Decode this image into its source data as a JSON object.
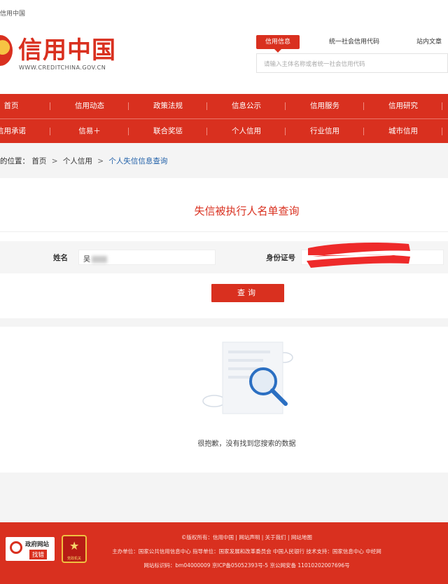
{
  "topbar": {
    "site_link": "信用中国"
  },
  "header": {
    "logo_text": "信用中国",
    "logo_url": "WWW.CREDITCHINA.GOV.CN",
    "search_tabs": [
      "信用信息",
      "统一社会信用代码",
      "站内文章"
    ],
    "search_placeholder": "请输入主体名称或者统一社会信用代码"
  },
  "nav": {
    "row1": [
      "首页",
      "信用动态",
      "政策法规",
      "信息公示",
      "信用服务",
      "信用研究"
    ],
    "row2": [
      "信用承诺",
      "信易＋",
      "联合奖惩",
      "个人信用",
      "行业信用",
      "城市信用"
    ]
  },
  "breadcrumb": {
    "prefix": "的位置：",
    "home": "首页",
    "section": "个人信用",
    "current": "个人失信信息查询",
    "sep": ">"
  },
  "query": {
    "title": "失信被执行人名单查询",
    "name_label": "姓名",
    "name_value": "吴",
    "id_label": "身份证号",
    "submit_label": "查询"
  },
  "result": {
    "empty_message": "很抱歉，没有找到您搜索的数据"
  },
  "footer": {
    "line1": "©版权所有：信用中国 | 网站声明 | 关于我们 | 网站地图",
    "line2": "主办单位：国家公共信用信息中心   指导单位：国家发展和改革委员会 中国人民银行   技术支持：国家信息中心 中经网",
    "line3": "网站标识码：bm04000009  京ICP备05052393号-5   京公网安备 11010202007696号",
    "gov_badge_title": "政府网站",
    "gov_badge_sub": "找错",
    "party_badge_text": "党政机关"
  },
  "colors": {
    "brand_red": "#d9301f",
    "link_blue": "#1f5fa8"
  }
}
